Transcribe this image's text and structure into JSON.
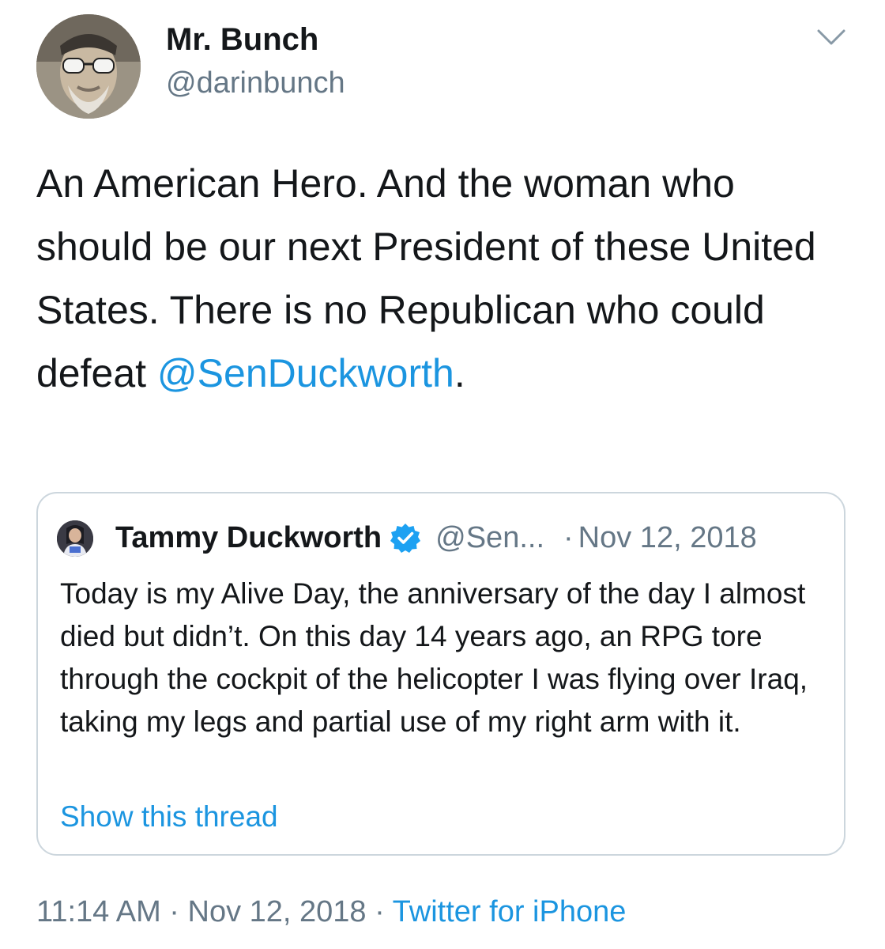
{
  "author": {
    "display_name": "Mr. Bunch",
    "handle": "@darinbunch"
  },
  "menu_icon": "chevron-down-icon",
  "tweet": {
    "text_part1": "An American Hero. And the woman who should be our next President of these United States. There is no Republican who could defeat ",
    "mention": "@SenDuckworth",
    "text_part2": "."
  },
  "quoted_tweet": {
    "display_name": "Tammy Duckworth",
    "verified_icon": "verified-badge-icon",
    "handle": "@Sen...",
    "separator": "·",
    "date": "Nov 12, 2018",
    "text": "Today is my Alive Day, the anniversary of the day I almost died but didn’t. On this day 14 years ago, an RPG tore through the cockpit of the helicopter I was flying over Iraq, taking my legs and partial use of my right arm with it.",
    "show_thread": "Show this thread"
  },
  "footer": {
    "time": "11:14 AM",
    "sep1": "·",
    "date": "Nov 12, 2018",
    "sep2": "·",
    "source": "Twitter for iPhone"
  },
  "colors": {
    "link": "#1b95e0",
    "secondary_text": "#657786",
    "border": "#ccd6dd"
  }
}
